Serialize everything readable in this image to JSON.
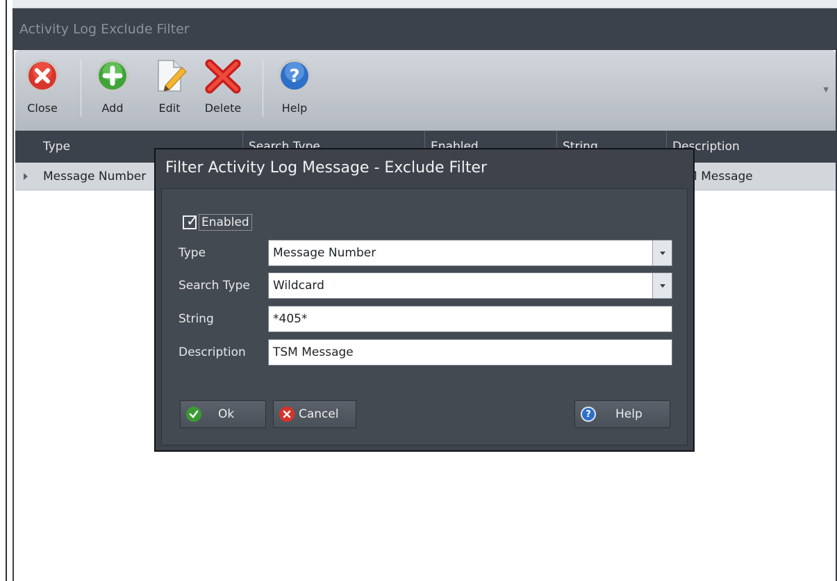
{
  "window": {
    "title": "Activity Log Exclude Filter"
  },
  "ribbon": {
    "buttons": [
      {
        "label": "Close",
        "icon": "close-circle-icon"
      },
      {
        "label": "Add",
        "icon": "add-circle-icon"
      },
      {
        "label": "Edit",
        "icon": "edit-document-icon"
      },
      {
        "label": "Delete",
        "icon": "delete-x-icon"
      },
      {
        "label": "Help",
        "icon": "help-circle-icon"
      }
    ]
  },
  "grid": {
    "columns": [
      "Type",
      "Search Type",
      "Enabled",
      "String",
      "Description"
    ],
    "rows": [
      {
        "type": "Message Number",
        "description": "TSM Message"
      }
    ]
  },
  "dialog": {
    "title": "Filter Activity Log Message - Exclude Filter",
    "enabled_label": "Enabled",
    "enabled_checked": true,
    "fields": {
      "type": {
        "label": "Type",
        "value": "Message Number"
      },
      "search_type": {
        "label": "Search Type",
        "value": "Wildcard"
      },
      "string": {
        "label": "String",
        "value": "*405*"
      },
      "description": {
        "label": "Description",
        "value": "TSM Message"
      }
    },
    "buttons": {
      "ok": "Ok",
      "cancel": "Cancel",
      "help": "Help"
    }
  },
  "colors": {
    "titlebar": "#3c424b",
    "dialog": "#3e434b",
    "ribbon": "#c3c8ce",
    "row_highlight": "#d3d7dc"
  }
}
